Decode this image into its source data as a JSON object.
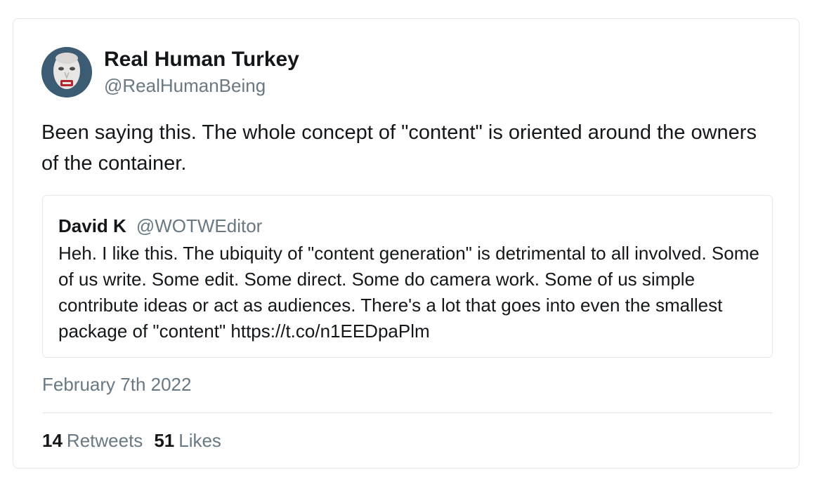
{
  "tweet": {
    "author": {
      "name": "Real Human Turkey",
      "handle": "@RealHumanBeing",
      "avatar_icon": "masked-face-avatar"
    },
    "text": "Been saying this. The whole concept of \"content\" is oriented around the owners of the container.",
    "quoted_tweet": {
      "name": "David K",
      "handle": "@WOTWEditor",
      "text": "Heh. I like this. The ubiquity of \"content generation\" is detrimental to all involved. Some of us write. Some edit. Some direct. Some do camera work. Some of us simple contribute ideas or act as audiences. There's a lot that goes into even the smallest package of \"content\" https://t.co/n1EEDpaPlm"
    },
    "date": "February 7th 2022",
    "stats": {
      "retweets_count": "14",
      "retweets_label": "Retweets",
      "likes_count": "51",
      "likes_label": "Likes"
    }
  },
  "colors": {
    "text_primary": "#14171a",
    "text_secondary": "#697882",
    "border": "#e1e8ed",
    "avatar_bg": "#3c5c73"
  }
}
